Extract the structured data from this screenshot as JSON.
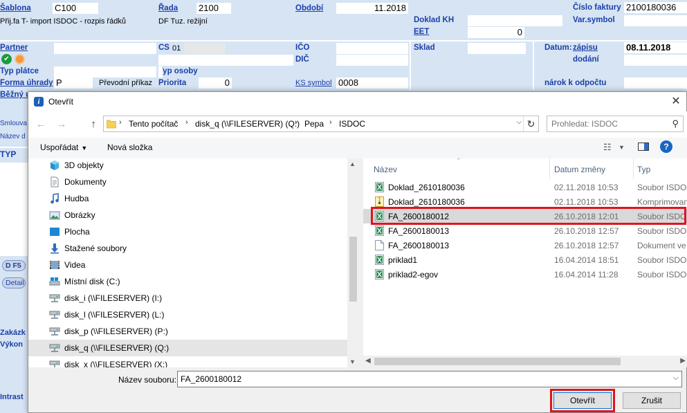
{
  "form": {
    "sablona_label": "Šablona",
    "sablona_value": "C100",
    "sablona_desc": "Přij.fa T- import ISDOC - rozpis řádků",
    "rada_label": "Řada",
    "rada_value": "2100",
    "rada_desc": "DF Tuz. režijní",
    "obdobi_label": "Období",
    "obdobi_value": "11.2018",
    "cislo_faktury_label": "Číslo faktury",
    "cislo_faktury_value": "2100180036",
    "var_symbol_label": "Var.symbol",
    "doklad_kh_label": "Doklad KH",
    "eet_label": "EET",
    "eet_value": "0",
    "partner_label": "Partner",
    "cs_label": "CS",
    "cs_value": "01",
    "ico_label": "IČO",
    "dic_label": "DIČ",
    "sklad_label": "Sklad",
    "datum_label": "Datum:",
    "zapisu_label": "zápisu",
    "zapisu_value": "08.11.2018",
    "dodani_label": "dodání",
    "typ_platce_label": "Typ plátce",
    "typ_osoby_label": "Typ osoby",
    "forma_uhrady_label": "Forma úhrady",
    "forma_uhrady_value": "P",
    "forma_uhrady_desc": "Převodní příkaz",
    "priorita_label": "Priorita",
    "priorita_value": "0",
    "ks_symbol_label": "KS symbol",
    "ks_symbol_value": "0008",
    "narok_label": "nárok k odpočtu",
    "bezny_label": "Běžný ú",
    "left_strip": [
      "Smlouva",
      "Název d",
      "TYP",
      "D F5",
      "Detail",
      "Zakázk",
      "Výkon",
      "Intrast"
    ]
  },
  "dialog": {
    "title": "Otevřít",
    "breadcrumb": [
      "Tento počítač",
      "disk_q (\\\\FILESERVER) (Q:)",
      "Pepa",
      "ISDOC"
    ],
    "search_placeholder": "Prohledat: ISDOC",
    "toolbar": {
      "organize": "Uspořádat",
      "new_folder": "Nová složka"
    },
    "nav_items": [
      {
        "label": "3D objekty",
        "icon": "cube-icon"
      },
      {
        "label": "Dokumenty",
        "icon": "document-icon"
      },
      {
        "label": "Hudba",
        "icon": "music-icon"
      },
      {
        "label": "Obrázky",
        "icon": "picture-icon"
      },
      {
        "label": "Plocha",
        "icon": "desktop-icon"
      },
      {
        "label": "Stažené soubory",
        "icon": "download-icon"
      },
      {
        "label": "Videa",
        "icon": "video-icon"
      },
      {
        "label": "Místní disk (C:)",
        "icon": "local-disk-icon"
      },
      {
        "label": "disk_i (\\\\FILESERVER) (I:)",
        "icon": "network-drive-icon"
      },
      {
        "label": "disk_l (\\\\FILESERVER) (L:)",
        "icon": "network-drive-icon"
      },
      {
        "label": "disk_p (\\\\FILESERVER) (P:)",
        "icon": "network-drive-icon"
      },
      {
        "label": "disk_q (\\\\FILESERVER) (Q:)",
        "icon": "network-drive-icon"
      },
      {
        "label": "disk_x (\\\\FILESERVER) (X:)",
        "icon": "network-drive-icon"
      }
    ],
    "selected_nav_index": 11,
    "columns": {
      "name": "Název",
      "date": "Datum změny",
      "type": "Typ"
    },
    "files": [
      {
        "name": "Doklad_2610180036",
        "date": "02.11.2018 10:53",
        "type": "Soubor ISDOC",
        "icon": "isdoc-file-icon"
      },
      {
        "name": "Doklad_2610180036",
        "date": "02.11.2018 10:53",
        "type": "Komprimovaný",
        "icon": "zip-file-icon"
      },
      {
        "name": "FA_2600180012",
        "date": "26.10.2018 12:01",
        "type": "Soubor ISDOC",
        "icon": "isdoc-file-icon"
      },
      {
        "name": "FA_2600180013",
        "date": "26.10.2018 12:57",
        "type": "Soubor ISDOC",
        "icon": "isdoc-file-icon"
      },
      {
        "name": "FA_2600180013",
        "date": "26.10.2018 12:57",
        "type": "Dokument ve",
        "icon": "blank-file-icon"
      },
      {
        "name": "priklad1",
        "date": "16.04.2014 18:51",
        "type": "Soubor ISDOC",
        "icon": "isdoc-file-icon"
      },
      {
        "name": "priklad2-egov",
        "date": "16.04.2014 11:28",
        "type": "Soubor ISDOC",
        "icon": "isdoc-file-icon"
      }
    ],
    "selected_file_index": 2,
    "filename_label": "Název souboru:",
    "filename_value": "FA_2600180012",
    "open_button": "Otevřít",
    "cancel_button": "Zrušit"
  },
  "colors": {
    "form_background": "#d6e4f4",
    "form_label": "#1b3fa8",
    "highlight_box": "#e0141e",
    "primary_border": "#0078d7"
  }
}
